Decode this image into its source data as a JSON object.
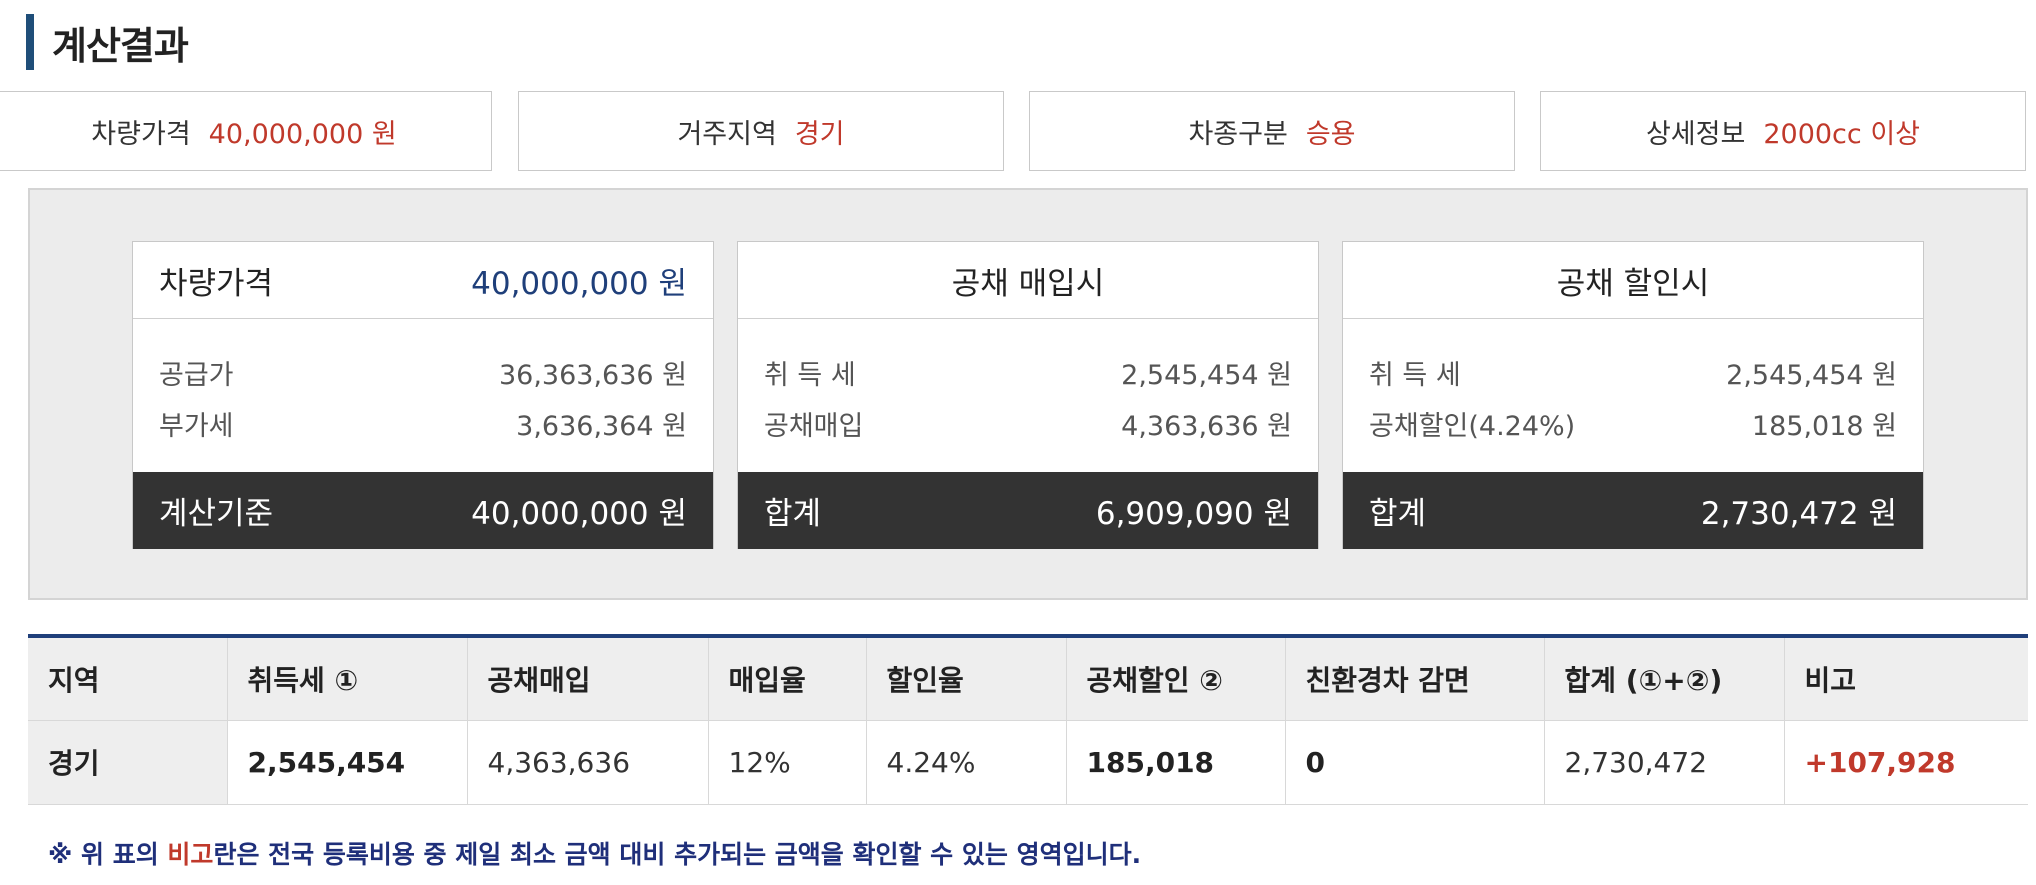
{
  "section_title": "계산결과",
  "conditions": [
    {
      "label": "차량가격",
      "value": "40,000,000 원"
    },
    {
      "label": "거주지역",
      "value": "경기"
    },
    {
      "label": "차종구분",
      "value": "승용"
    },
    {
      "label": "상세정보",
      "value": "2000cc 이상"
    }
  ],
  "card_price": {
    "header_label": "차량가격",
    "header_value": "40,000,000 원",
    "rows": [
      {
        "label": "공급가",
        "value": "36,363,636 원"
      },
      {
        "label": "부가세",
        "value": "3,636,364 원"
      }
    ],
    "footer_label": "계산기준",
    "footer_value": "40,000,000 원"
  },
  "card_purchase": {
    "header": "공채 매입시",
    "rows": [
      {
        "label": "취 득 세",
        "value": "2,545,454 원"
      },
      {
        "label": "공채매입",
        "value": "4,363,636 원"
      }
    ],
    "footer_label": "합계",
    "footer_value": "6,909,090 원"
  },
  "card_discount": {
    "header": "공채 할인시",
    "rows": [
      {
        "label": "취 득 세",
        "value": "2,545,454 원"
      },
      {
        "label": "공채할인(4.24%)",
        "value": "185,018 원"
      }
    ],
    "footer_label": "합계",
    "footer_value": "2,730,472 원"
  },
  "table": {
    "headers": [
      "지역",
      "취득세 ①",
      "공채매입",
      "매입율",
      "할인율",
      "공채할인 ②",
      "친환경차 감면",
      "합계 (①+②)",
      "비고"
    ],
    "row": [
      "경기",
      "2,545,454",
      "4,363,636",
      "12%",
      "4.24%",
      "185,018",
      "0",
      "2,730,472",
      "+107,928"
    ]
  },
  "note": {
    "prefix": "※ 위 표의 ",
    "highlight": "비고",
    "suffix": "란은 전국 등록비용 중 제일 최소 금액 대비 추가되는 금액을 확인할 수 있는 영역입니다."
  },
  "colors": {
    "accent_navy": "#1f3f7a",
    "value_red": "#c0392b",
    "footer_dark": "#333333"
  }
}
